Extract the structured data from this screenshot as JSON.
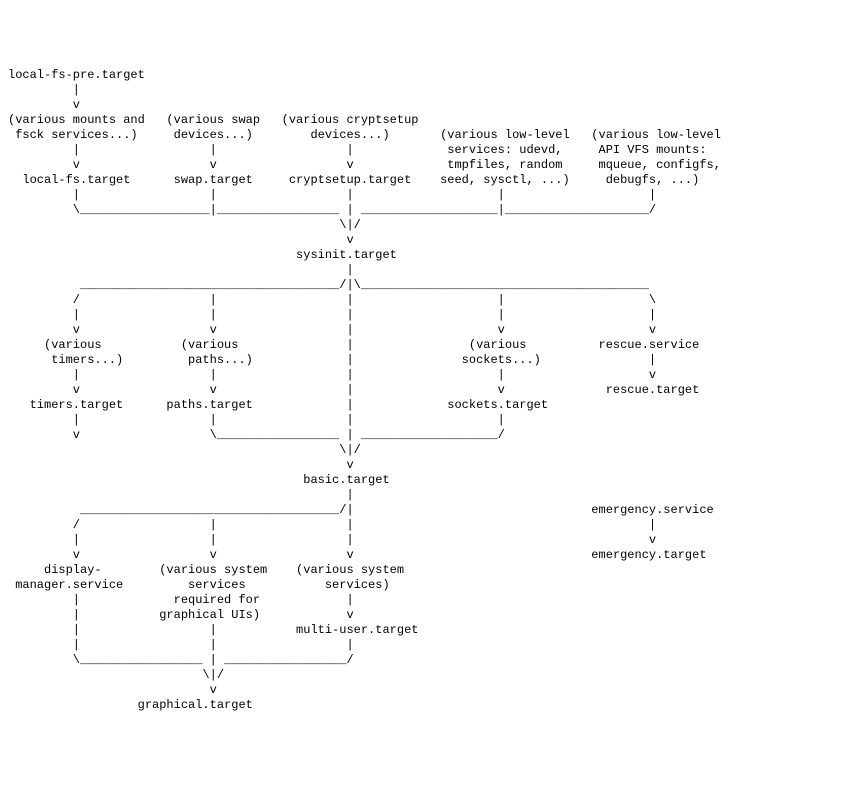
{
  "diagram_type": "systemd-boot-target-dependency-graph",
  "nodes": {
    "local_fs_pre": "local-fs-pre.target",
    "mounts_fsck": "(various mounts and\n fsck services...)",
    "local_fs": "local-fs.target",
    "swap_devices": "(various swap\n devices...)",
    "swap": "swap.target",
    "cryptsetup_devices": "(various cryptsetup\n devices...)",
    "cryptsetup": "cryptsetup.target",
    "low_level_services": "(various low-level\n services: udevd,\n tmpfiles, random\n seed, sysctl, ...)",
    "low_level_api_vfs": "(various low-level\n API VFS mounts:\n mqueue, configfs,\n debugfs, ...)",
    "sysinit": "sysinit.target",
    "various_timers": "(various\n timers...)",
    "timers": "timers.target",
    "various_paths": "(various\n paths...)",
    "paths": "paths.target",
    "various_sockets": "(various\n sockets...)",
    "sockets": "sockets.target",
    "rescue_service": "rescue.service",
    "rescue": "rescue.target",
    "basic": "basic.target",
    "display_manager": "display-\n manager.service",
    "sys_services_graphical": "(various system\n services\n required for\n graphical UIs)",
    "sys_services": "(various system\n services)",
    "multi_user": "multi-user.target",
    "graphical": "graphical.target",
    "emergency_service": "emergency.service",
    "emergency": "emergency.target"
  },
  "ascii": "local-fs-pre.target\n         |\n         v\n(various mounts and   (various swap   (various cryptsetup\n fsck services...)     devices...)        devices...)       (various low-level   (various low-level\n         |                  |                  |             services: udevd,     API VFS mounts:\n         v                  v                  v             tmpfiles, random     mqueue, configfs,\n  local-fs.target      swap.target     cryptsetup.target    seed, sysctl, ...)     debugfs, ...)\n         |                  |                  |                    |                    |\n         \\__________________|_________________ | ___________________|____________________/\n                                              \\|/\n                                               v\n                                        sysinit.target\n                                               |\n          ____________________________________/|\\________________________________________\n         /                  |                  |                    |                    \\\n         |                  |                  |                    |                    |\n         v                  v                  |                    v                    v\n     (various           (various               |                (various          rescue.service\n      timers...)         paths...)             |               sockets...)               |\n         |                  |                  |                    |                    v\n         v                  v                  |                    v              rescue.target\n   timers.target      paths.target             |             sockets.target\n         |                  |                  |                    |\n         v                  \\_________________ | ___________________/\n                                              \\|/\n                                               v\n                                         basic.target\n                                               |\n          ____________________________________/|                                 emergency.service\n         /                  |                  |                                         |\n         |                  |                  |                                         v\n         v                  v                  v                                 emergency.target\n     display-        (various system    (various system\n manager.service         services           services)\n         |             required for            |\n         |           graphical UIs)            v\n         |                  |           multi-user.target\n         |                  |                  |\n         \\_________________ | _________________/\n                           \\|/\n                            v\n                  graphical.target"
}
